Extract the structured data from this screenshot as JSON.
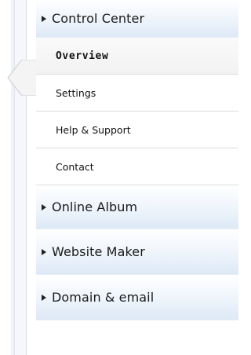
{
  "menu": {
    "sections": [
      {
        "label": "Control Center",
        "expanded": true,
        "icon": "triangle-right-icon",
        "items": [
          {
            "label": "Overview",
            "active": true
          },
          {
            "label": "Settings",
            "active": false
          },
          {
            "label": "Help & Support",
            "active": false
          },
          {
            "label": "Contact",
            "active": false
          }
        ]
      },
      {
        "label": "Online Album",
        "expanded": false,
        "icon": "triangle-right-icon"
      },
      {
        "label": "Website Maker",
        "expanded": false,
        "icon": "triangle-right-icon"
      },
      {
        "label": "Domain & email",
        "expanded": false,
        "icon": "triangle-right-icon"
      }
    ]
  },
  "colors": {
    "section_gradient_top": "#ffffff",
    "section_gradient_bottom": "#dde9f6",
    "divider": "#dddddd",
    "active_bg": "#f2f2f2",
    "text": "#111111"
  }
}
